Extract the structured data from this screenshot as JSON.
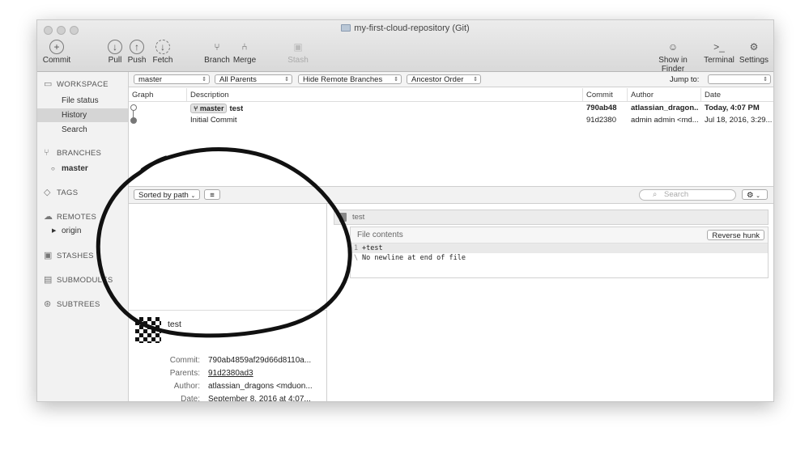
{
  "window": {
    "title": "my-first-cloud-repository (Git)"
  },
  "toolbar": {
    "commit": "Commit",
    "pull": "Pull",
    "push": "Push",
    "fetch": "Fetch",
    "branch": "Branch",
    "merge": "Merge",
    "stash": "Stash",
    "show_in_finder": "Show in Finder",
    "terminal": "Terminal",
    "settings": "Settings"
  },
  "sidebar": {
    "workspace": "WORKSPACE",
    "workspace_items": [
      "File status",
      "History",
      "Search"
    ],
    "branches": "BRANCHES",
    "branch_items": [
      "master"
    ],
    "tags": "TAGS",
    "remotes": "REMOTES",
    "remote_items": [
      "origin"
    ],
    "stashes": "STASHES",
    "submodules": "SUBMODULES",
    "subtrees": "SUBTREES"
  },
  "filters": {
    "branch": "master",
    "parents": "All Parents",
    "remote": "Hide Remote Branches",
    "order": "Ancestor Order",
    "jump_to": "Jump to:"
  },
  "table": {
    "headers": {
      "graph": "Graph",
      "description": "Description",
      "commit": "Commit",
      "author": "Author",
      "date": "Date"
    },
    "rows": [
      {
        "tag": "master",
        "description": "test",
        "commit": "790ab48",
        "author": "atlassian_dragon...",
        "date": "Today, 4:07 PM"
      },
      {
        "tag": "",
        "description": "Initial Commit",
        "commit": "91d2380",
        "author": "admin admin <md...",
        "date": "Jul 18, 2016, 3:29..."
      }
    ]
  },
  "lower": {
    "sort": "Sorted by path",
    "search_placeholder": "Search"
  },
  "detail": {
    "message": "test",
    "labels": {
      "commit": "Commit:",
      "parents": "Parents:",
      "author": "Author:",
      "date": "Date:"
    },
    "commit": "790ab4859af29d66d8110a...",
    "parents": "91d2380ad3",
    "author": "atlassian_dragons <mduon...",
    "date": "September 8, 2016 at 4:07..."
  },
  "diff": {
    "file": "test",
    "hunk_title": "File contents",
    "reverse_hunk": "Reverse hunk",
    "line1_gutter": "1",
    "line1": "+test",
    "line2_gutter": "\\",
    "line2": "No newline at end of file"
  }
}
